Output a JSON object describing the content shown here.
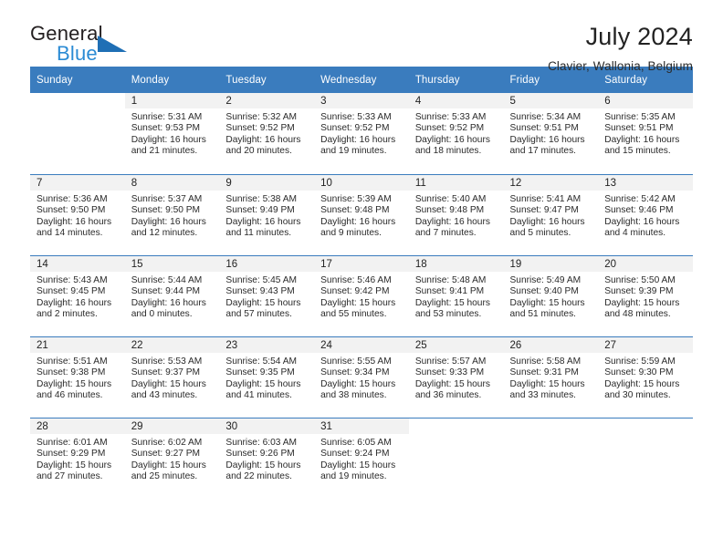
{
  "brand": {
    "name_part1": "General",
    "name_part2": "Blue"
  },
  "header": {
    "title": "July 2024",
    "subtitle": "Clavier, Wallonia, Belgium"
  },
  "colors": {
    "header_blue": "#3a7cbe",
    "brand_blue": "#2b8bd4",
    "daynum_band": "#f2f2f2"
  },
  "weekday_headers": [
    "Sunday",
    "Monday",
    "Tuesday",
    "Wednesday",
    "Thursday",
    "Friday",
    "Saturday"
  ],
  "labels": {
    "sunrise_prefix": "Sunrise:",
    "sunset_prefix": "Sunset:",
    "daylight_prefix": "Daylight:"
  },
  "weeks": [
    [
      {
        "day": ""
      },
      {
        "day": "1",
        "sunrise": "Sunrise: 5:31 AM",
        "sunset": "Sunset: 9:53 PM",
        "daylight_line1": "Daylight: 16 hours",
        "daylight_line2": "and 21 minutes."
      },
      {
        "day": "2",
        "sunrise": "Sunrise: 5:32 AM",
        "sunset": "Sunset: 9:52 PM",
        "daylight_line1": "Daylight: 16 hours",
        "daylight_line2": "and 20 minutes."
      },
      {
        "day": "3",
        "sunrise": "Sunrise: 5:33 AM",
        "sunset": "Sunset: 9:52 PM",
        "daylight_line1": "Daylight: 16 hours",
        "daylight_line2": "and 19 minutes."
      },
      {
        "day": "4",
        "sunrise": "Sunrise: 5:33 AM",
        "sunset": "Sunset: 9:52 PM",
        "daylight_line1": "Daylight: 16 hours",
        "daylight_line2": "and 18 minutes."
      },
      {
        "day": "5",
        "sunrise": "Sunrise: 5:34 AM",
        "sunset": "Sunset: 9:51 PM",
        "daylight_line1": "Daylight: 16 hours",
        "daylight_line2": "and 17 minutes."
      },
      {
        "day": "6",
        "sunrise": "Sunrise: 5:35 AM",
        "sunset": "Sunset: 9:51 PM",
        "daylight_line1": "Daylight: 16 hours",
        "daylight_line2": "and 15 minutes."
      }
    ],
    [
      {
        "day": "7",
        "sunrise": "Sunrise: 5:36 AM",
        "sunset": "Sunset: 9:50 PM",
        "daylight_line1": "Daylight: 16 hours",
        "daylight_line2": "and 14 minutes."
      },
      {
        "day": "8",
        "sunrise": "Sunrise: 5:37 AM",
        "sunset": "Sunset: 9:50 PM",
        "daylight_line1": "Daylight: 16 hours",
        "daylight_line2": "and 12 minutes."
      },
      {
        "day": "9",
        "sunrise": "Sunrise: 5:38 AM",
        "sunset": "Sunset: 9:49 PM",
        "daylight_line1": "Daylight: 16 hours",
        "daylight_line2": "and 11 minutes."
      },
      {
        "day": "10",
        "sunrise": "Sunrise: 5:39 AM",
        "sunset": "Sunset: 9:48 PM",
        "daylight_line1": "Daylight: 16 hours",
        "daylight_line2": "and 9 minutes."
      },
      {
        "day": "11",
        "sunrise": "Sunrise: 5:40 AM",
        "sunset": "Sunset: 9:48 PM",
        "daylight_line1": "Daylight: 16 hours",
        "daylight_line2": "and 7 minutes."
      },
      {
        "day": "12",
        "sunrise": "Sunrise: 5:41 AM",
        "sunset": "Sunset: 9:47 PM",
        "daylight_line1": "Daylight: 16 hours",
        "daylight_line2": "and 5 minutes."
      },
      {
        "day": "13",
        "sunrise": "Sunrise: 5:42 AM",
        "sunset": "Sunset: 9:46 PM",
        "daylight_line1": "Daylight: 16 hours",
        "daylight_line2": "and 4 minutes."
      }
    ],
    [
      {
        "day": "14",
        "sunrise": "Sunrise: 5:43 AM",
        "sunset": "Sunset: 9:45 PM",
        "daylight_line1": "Daylight: 16 hours",
        "daylight_line2": "and 2 minutes."
      },
      {
        "day": "15",
        "sunrise": "Sunrise: 5:44 AM",
        "sunset": "Sunset: 9:44 PM",
        "daylight_line1": "Daylight: 16 hours",
        "daylight_line2": "and 0 minutes."
      },
      {
        "day": "16",
        "sunrise": "Sunrise: 5:45 AM",
        "sunset": "Sunset: 9:43 PM",
        "daylight_line1": "Daylight: 15 hours",
        "daylight_line2": "and 57 minutes."
      },
      {
        "day": "17",
        "sunrise": "Sunrise: 5:46 AM",
        "sunset": "Sunset: 9:42 PM",
        "daylight_line1": "Daylight: 15 hours",
        "daylight_line2": "and 55 minutes."
      },
      {
        "day": "18",
        "sunrise": "Sunrise: 5:48 AM",
        "sunset": "Sunset: 9:41 PM",
        "daylight_line1": "Daylight: 15 hours",
        "daylight_line2": "and 53 minutes."
      },
      {
        "day": "19",
        "sunrise": "Sunrise: 5:49 AM",
        "sunset": "Sunset: 9:40 PM",
        "daylight_line1": "Daylight: 15 hours",
        "daylight_line2": "and 51 minutes."
      },
      {
        "day": "20",
        "sunrise": "Sunrise: 5:50 AM",
        "sunset": "Sunset: 9:39 PM",
        "daylight_line1": "Daylight: 15 hours",
        "daylight_line2": "and 48 minutes."
      }
    ],
    [
      {
        "day": "21",
        "sunrise": "Sunrise: 5:51 AM",
        "sunset": "Sunset: 9:38 PM",
        "daylight_line1": "Daylight: 15 hours",
        "daylight_line2": "and 46 minutes."
      },
      {
        "day": "22",
        "sunrise": "Sunrise: 5:53 AM",
        "sunset": "Sunset: 9:37 PM",
        "daylight_line1": "Daylight: 15 hours",
        "daylight_line2": "and 43 minutes."
      },
      {
        "day": "23",
        "sunrise": "Sunrise: 5:54 AM",
        "sunset": "Sunset: 9:35 PM",
        "daylight_line1": "Daylight: 15 hours",
        "daylight_line2": "and 41 minutes."
      },
      {
        "day": "24",
        "sunrise": "Sunrise: 5:55 AM",
        "sunset": "Sunset: 9:34 PM",
        "daylight_line1": "Daylight: 15 hours",
        "daylight_line2": "and 38 minutes."
      },
      {
        "day": "25",
        "sunrise": "Sunrise: 5:57 AM",
        "sunset": "Sunset: 9:33 PM",
        "daylight_line1": "Daylight: 15 hours",
        "daylight_line2": "and 36 minutes."
      },
      {
        "day": "26",
        "sunrise": "Sunrise: 5:58 AM",
        "sunset": "Sunset: 9:31 PM",
        "daylight_line1": "Daylight: 15 hours",
        "daylight_line2": "and 33 minutes."
      },
      {
        "day": "27",
        "sunrise": "Sunrise: 5:59 AM",
        "sunset": "Sunset: 9:30 PM",
        "daylight_line1": "Daylight: 15 hours",
        "daylight_line2": "and 30 minutes."
      }
    ],
    [
      {
        "day": "28",
        "sunrise": "Sunrise: 6:01 AM",
        "sunset": "Sunset: 9:29 PM",
        "daylight_line1": "Daylight: 15 hours",
        "daylight_line2": "and 27 minutes."
      },
      {
        "day": "29",
        "sunrise": "Sunrise: 6:02 AM",
        "sunset": "Sunset: 9:27 PM",
        "daylight_line1": "Daylight: 15 hours",
        "daylight_line2": "and 25 minutes."
      },
      {
        "day": "30",
        "sunrise": "Sunrise: 6:03 AM",
        "sunset": "Sunset: 9:26 PM",
        "daylight_line1": "Daylight: 15 hours",
        "daylight_line2": "and 22 minutes."
      },
      {
        "day": "31",
        "sunrise": "Sunrise: 6:05 AM",
        "sunset": "Sunset: 9:24 PM",
        "daylight_line1": "Daylight: 15 hours",
        "daylight_line2": "and 19 minutes."
      },
      {
        "day": ""
      },
      {
        "day": ""
      },
      {
        "day": ""
      }
    ]
  ]
}
